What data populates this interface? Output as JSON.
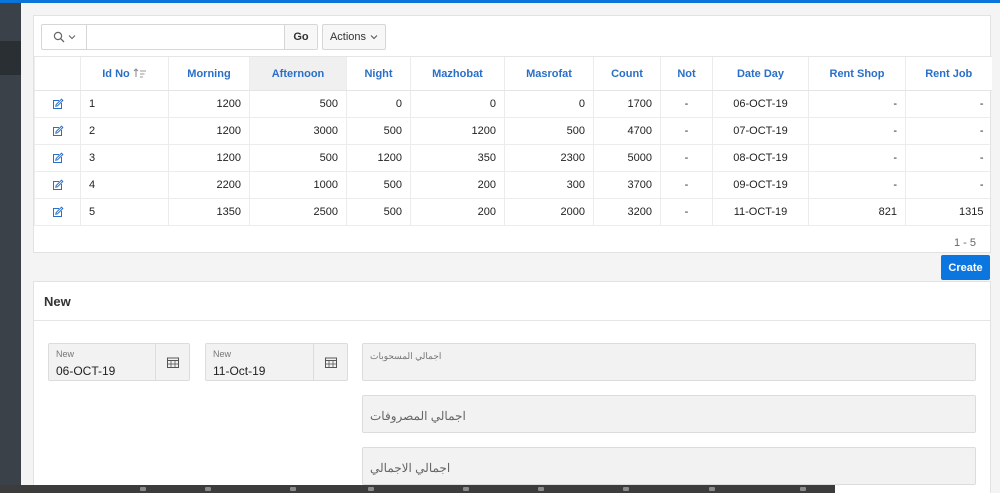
{
  "toolbar": {
    "search_placeholder": "",
    "go_label": "Go",
    "actions_label": "Actions"
  },
  "table": {
    "columns": [
      "Id No",
      "Morning",
      "Afternoon",
      "Night",
      "Mazhobat",
      "Masrofat",
      "Count",
      "Not",
      "Date Day",
      "Rent Shop",
      "Rent Job"
    ],
    "rows": [
      [
        "1",
        "1200",
        "500",
        "0",
        "0",
        "0",
        "1700",
        "-",
        "06-OCT-19",
        "-",
        "-"
      ],
      [
        "2",
        "1200",
        "3000",
        "500",
        "1200",
        "500",
        "4700",
        "-",
        "07-OCT-19",
        "-",
        "-"
      ],
      [
        "3",
        "1200",
        "500",
        "1200",
        "350",
        "2300",
        "5000",
        "-",
        "08-OCT-19",
        "-",
        "-"
      ],
      [
        "4",
        "2200",
        "1000",
        "500",
        "200",
        "300",
        "3700",
        "-",
        "09-OCT-19",
        "-",
        "-"
      ],
      [
        "5",
        "1350",
        "2500",
        "500",
        "200",
        "2000",
        "3200",
        "-",
        "11-OCT-19",
        "821",
        "1315"
      ]
    ]
  },
  "pagination": "1 - 5",
  "create_label": "Create",
  "new_region": {
    "title": "New",
    "date_from": {
      "label": "New",
      "value": "06-OCT-19"
    },
    "date_to": {
      "label": "New",
      "value": "11-Oct-19"
    },
    "total_withdrawals": "اجمالي المسحوبات",
    "total_expenses": "اجمالي المصروفات",
    "grand_total": "اجمالي الاجمالي"
  },
  "colors": {
    "accent": "#0b76e0",
    "header_text": "#2a6fc7",
    "sidebar": "#3b4148"
  }
}
